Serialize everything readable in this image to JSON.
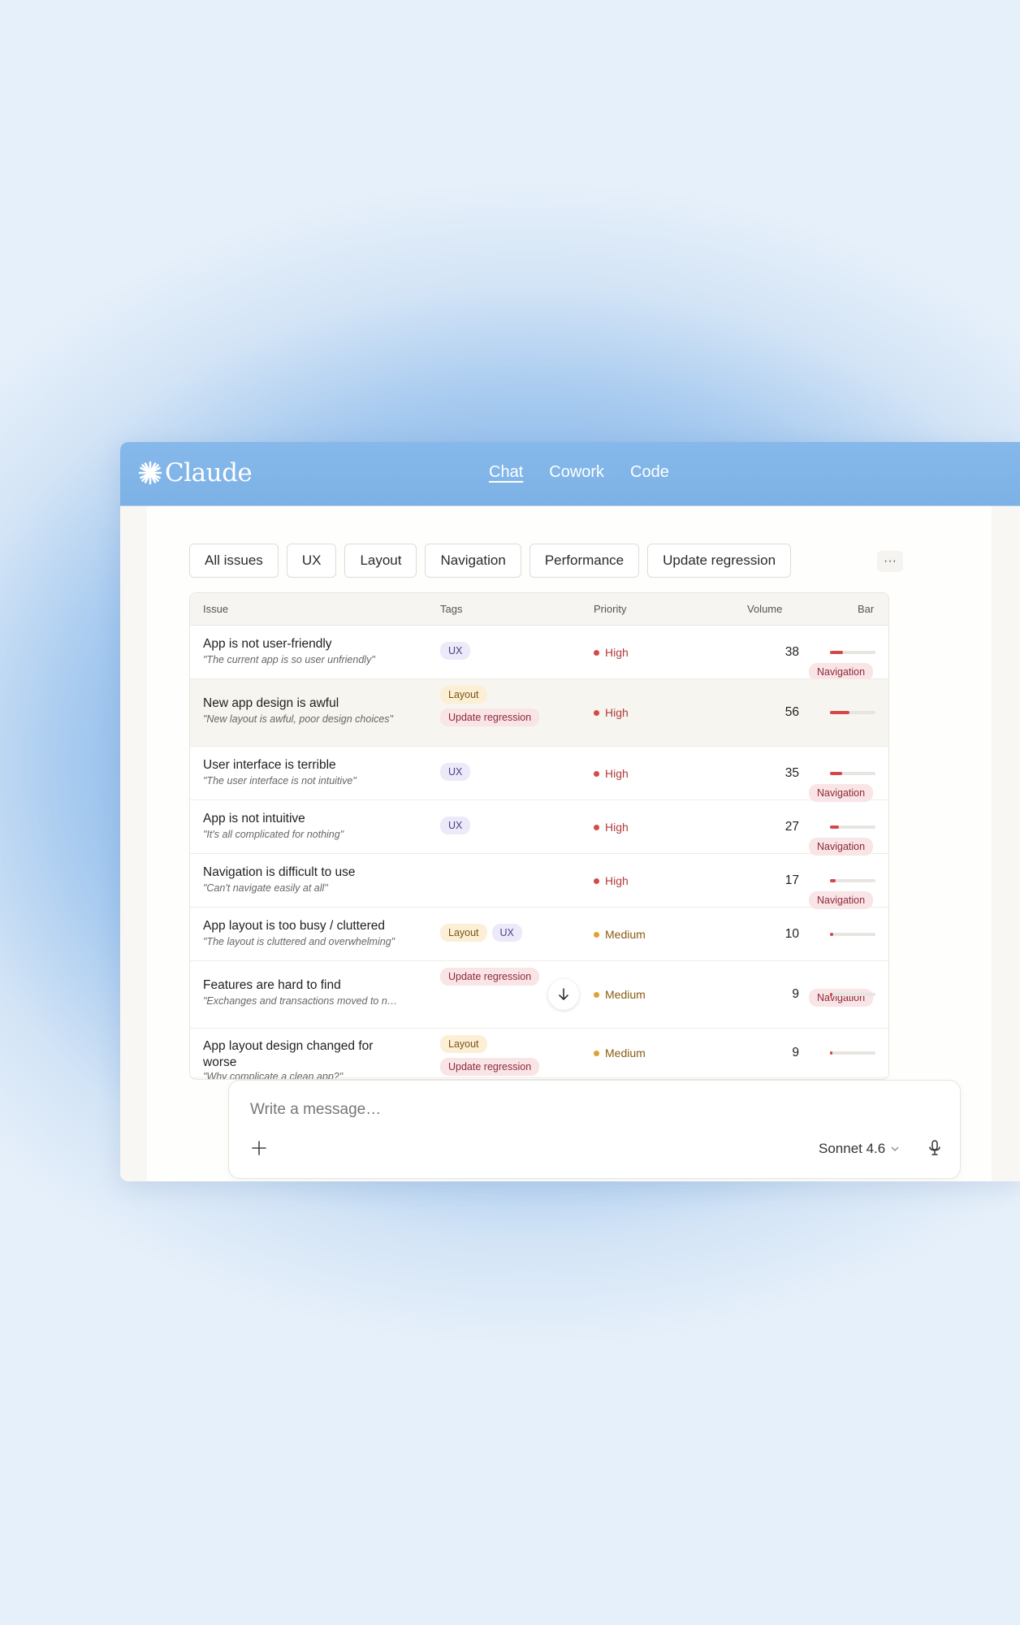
{
  "app": {
    "name": "Claude"
  },
  "nav": {
    "tabs": [
      {
        "label": "Chat"
      },
      {
        "label": "Cowork"
      },
      {
        "label": "Code"
      }
    ]
  },
  "filters": [
    "All issues",
    "UX",
    "Layout",
    "Navigation",
    "Performance",
    "Update regression"
  ],
  "more_label": "···",
  "table": {
    "headers": {
      "issue": "Issue",
      "tags": "Tags",
      "priority": "Priority",
      "volume": "Volume",
      "bar": "Bar"
    },
    "rows": [
      {
        "title": "App is not user-friendly",
        "quote": "\"The current app is so user unfriendly\"",
        "tags": [
          "UX",
          "Navigation"
        ],
        "priority": "High",
        "volume": "38",
        "bar": 0.28
      },
      {
        "title": "New app design is awful",
        "quote": "\"New layout is awful, poor design choices\"",
        "tags": [
          "Layout",
          "Update regression"
        ],
        "priority": "High",
        "volume": "56",
        "bar": 0.42
      },
      {
        "title": "User interface is terrible",
        "quote": "\"The user interface is not intuitive\"",
        "tags": [
          "UX",
          "Navigation"
        ],
        "priority": "High",
        "volume": "35",
        "bar": 0.26
      },
      {
        "title": "App is not intuitive",
        "quote": "\"It's all complicated for nothing\"",
        "tags": [
          "UX",
          "Navigation"
        ],
        "priority": "High",
        "volume": "27",
        "bar": 0.2
      },
      {
        "title": "Navigation is difficult to use",
        "quote": "\"Can't navigate easily at all\"",
        "tags": [
          "Navigation"
        ],
        "priority": "High",
        "volume": "17",
        "bar": 0.12
      },
      {
        "title": "App layout is too busy / cluttered",
        "quote": "\"The layout is cluttered and overwhelming\"",
        "tags": [
          "Layout",
          "UX"
        ],
        "priority": "Medium",
        "volume": "10",
        "bar": 0.07
      },
      {
        "title": "Features are hard to find",
        "quote": "\"Exchanges and transactions moved to n…",
        "tags": [
          "Navigation",
          "Update regression"
        ],
        "priority": "Medium",
        "volume": "9",
        "bar": 0.06
      },
      {
        "title": "App layout design changed for worse",
        "quote": "\"Why complicate a clean app?\"",
        "tags": [
          "Layout",
          "Update regression"
        ],
        "priority": "Medium",
        "volume": "9",
        "bar": 0.06
      }
    ]
  },
  "composer": {
    "placeholder": "Write a message…",
    "model": "Sonnet 4.6"
  },
  "colors": {
    "accent_bar": "#d24848",
    "topbar": "#7db2e6",
    "high": "#d44a4a",
    "medium": "#e0a035"
  }
}
